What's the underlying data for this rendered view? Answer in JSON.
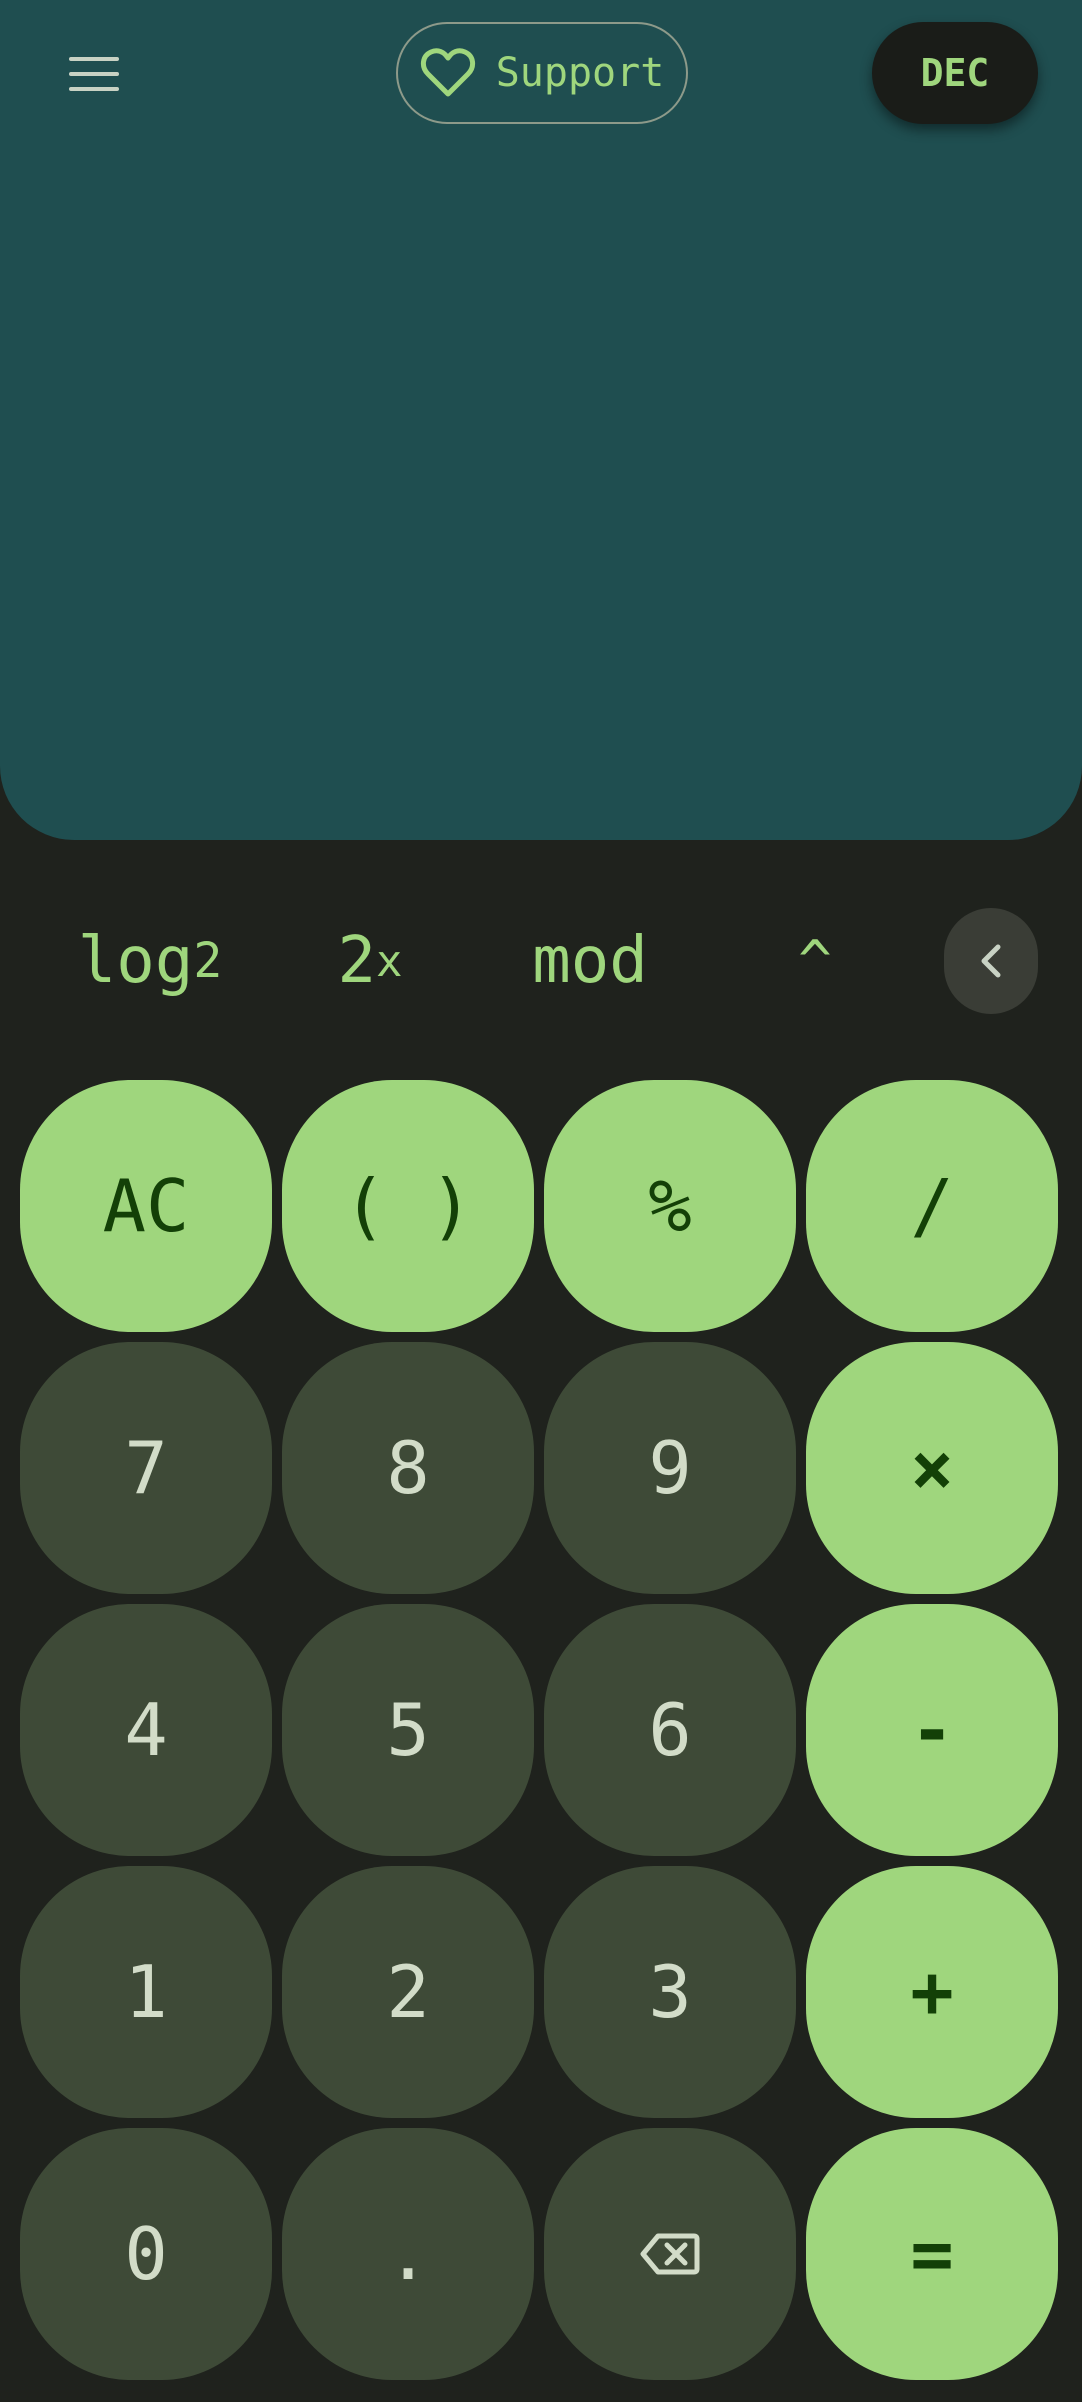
{
  "top_bar": {
    "menu_icon": "hamburger-menu-icon",
    "support_label": "Support",
    "support_icon": "heart-outline-icon",
    "mode_label": "DEC"
  },
  "scientific_row": {
    "log2": {
      "base": "log",
      "sub": "2"
    },
    "pow2": {
      "base": "2",
      "sup": "x"
    },
    "mod": "mod",
    "power": "^",
    "collapse_icon": "chevron-left-icon"
  },
  "keypad": {
    "clear": "AC",
    "parentheses": "( )",
    "percent": "%",
    "divide": "/",
    "seven": "7",
    "eight": "8",
    "nine": "9",
    "multiply": "×",
    "four": "4",
    "five": "5",
    "six": "6",
    "minus": "-",
    "one": "1",
    "two": "2",
    "three": "3",
    "plus": "+",
    "zero": "0",
    "decimal": ".",
    "backspace_icon": "backspace-icon",
    "equals": "="
  },
  "colors": {
    "display_bg": "#1f4e50",
    "app_bg": "#1f221d",
    "accent": "#9fd67d",
    "number_key_bg": "#3e4a37",
    "operator_text": "#134007"
  }
}
